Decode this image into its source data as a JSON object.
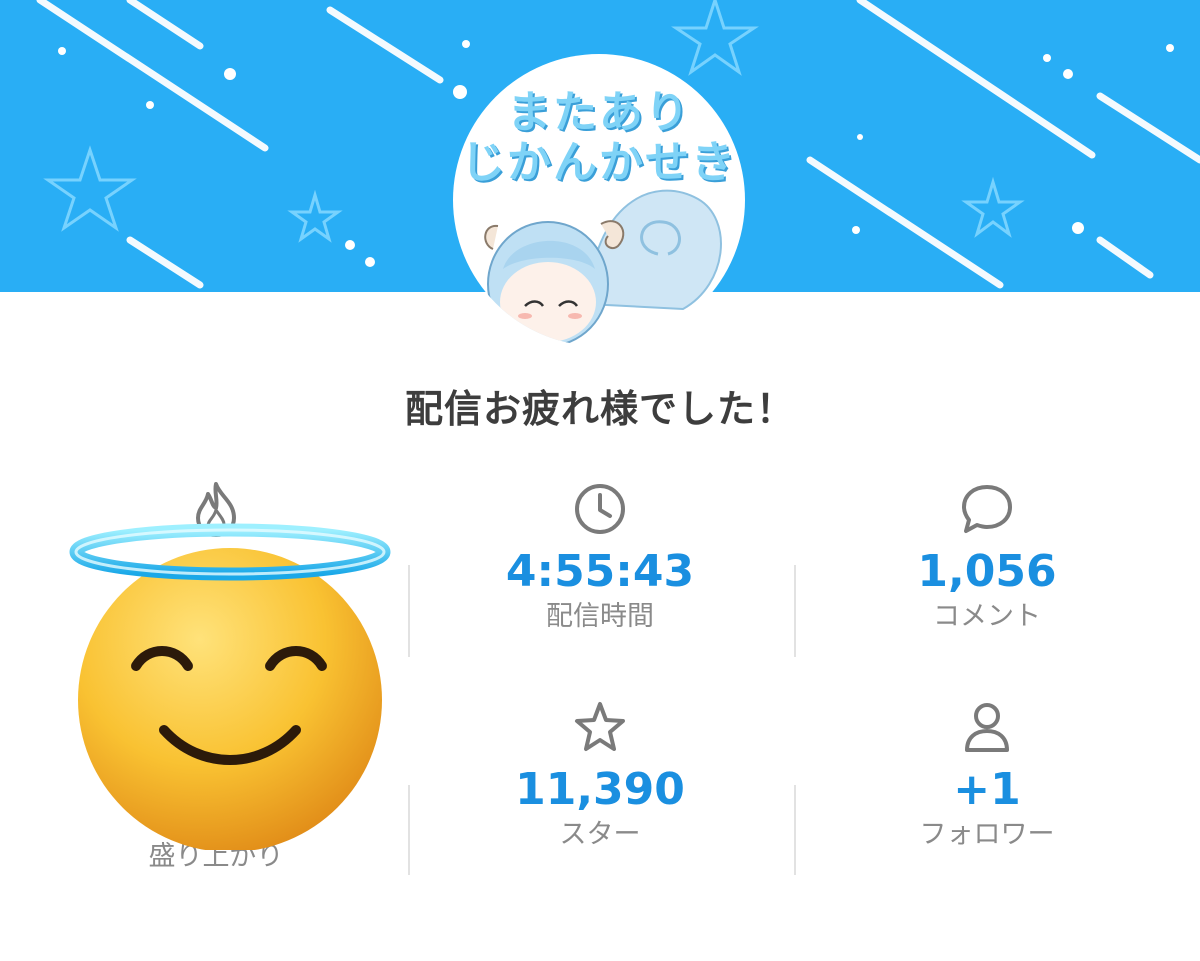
{
  "header": {
    "avatar_line1": "またあり",
    "avatar_line2": "じかんかせき",
    "avatar_icon": "chibi-sheep-girl-illustration",
    "banner_color": "#29aef5"
  },
  "title": "配信お疲れ様でした！",
  "stats": {
    "excitement": {
      "label": "盛り上がり",
      "icon": "fire-icon"
    },
    "duration": {
      "value": "4:55:43",
      "label": "配信時間",
      "icon": "clock-icon"
    },
    "comments": {
      "value": "1,056",
      "label": "コメント",
      "icon": "speech-bubble-icon"
    },
    "stars": {
      "value": "11,390",
      "label": "スター",
      "icon": "star-icon"
    },
    "followers": {
      "value": "+1",
      "label": "フォロワー",
      "icon": "person-icon"
    }
  },
  "overlay": {
    "emoji": "smiling-face-with-halo"
  },
  "colors": {
    "value": "#1a8fe0",
    "label": "#8a8a8a",
    "title": "#3d3d3d"
  }
}
